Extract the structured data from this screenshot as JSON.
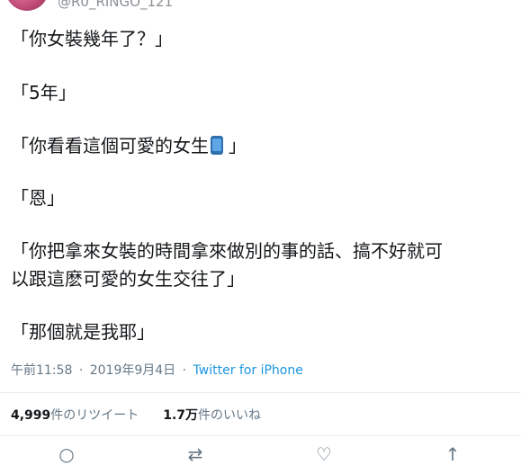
{
  "tweet": {
    "handle": "@R0_RINGO_121",
    "lines": [
      "「你女裝幾年了？」",
      "「5年」",
      "「你看看這個可愛的女生",
      "」",
      "「恩」",
      "「你把拿來女裝的時間拿來做別的事的話、搞不好就可",
      "以跟這麽可愛的女生交往了」",
      "「那個就是我耶」"
    ],
    "time": "午前11:58",
    "separator": "·",
    "date": "2019年9月4日",
    "source": "Twitter for iPhone",
    "retweets": {
      "count": "4,999",
      "label": "件のリツイート"
    },
    "likes": {
      "count": "1.7万",
      "label": "件のいいね"
    }
  }
}
